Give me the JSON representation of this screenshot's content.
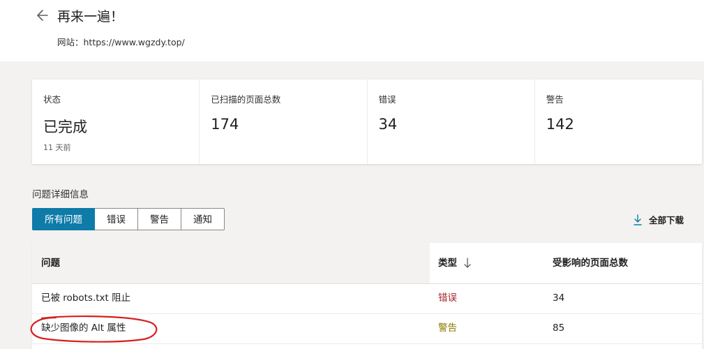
{
  "header": {
    "title": "再来一遍！",
    "site_text": "网站：https://www.wgzdy.top/",
    "back_icon": "arrow-left-icon"
  },
  "summary": [
    {
      "label": "状态",
      "value": "已完成",
      "sub": "11 天前"
    },
    {
      "label": "已扫描的页面总数",
      "value": "174"
    },
    {
      "label": "错误",
      "value": "34"
    },
    {
      "label": "警告",
      "value": "142"
    }
  ],
  "issues_section": {
    "title": "问题详细信息",
    "tabs": [
      "所有问题",
      "错误",
      "警告",
      "通知"
    ],
    "active_tab": 0,
    "download_label": "全部下载",
    "download_icon": "download-icon"
  },
  "table": {
    "columns": [
      "问题",
      "类型",
      "受影响的页面总数"
    ],
    "sort_icon": "sort-down-arrow-icon",
    "rows": [
      {
        "issue": "已被 robots.txt 阻止",
        "type": "错误",
        "count": "34"
      },
      {
        "issue": "缺少图像的 Alt 属性",
        "type": "警告",
        "count": "85"
      }
    ]
  },
  "colors": {
    "accent": "#0e7ba8",
    "error": "#a4262c",
    "warning": "#8a7a00",
    "annotation": "#d42020"
  }
}
